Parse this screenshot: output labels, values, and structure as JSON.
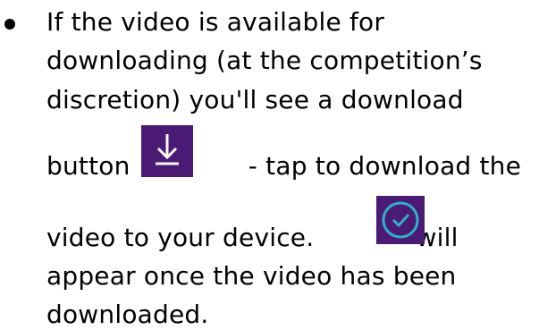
{
  "bullet": {
    "line1": "If the video is available for",
    "line2": "downloading (at the competition’s",
    "line3": "discretion) you'll see a download",
    "line4_before": "button",
    "line4_after": "- tap to download the",
    "line5_before": "video to your device.",
    "line5_after": "will",
    "line6": "appear once the video has been",
    "line7": "downloaded."
  },
  "icons": {
    "download": "download-icon",
    "downloaded": "check-circle-icon",
    "background_color": "#4b1a74",
    "check_color": "#2fb3c7"
  }
}
